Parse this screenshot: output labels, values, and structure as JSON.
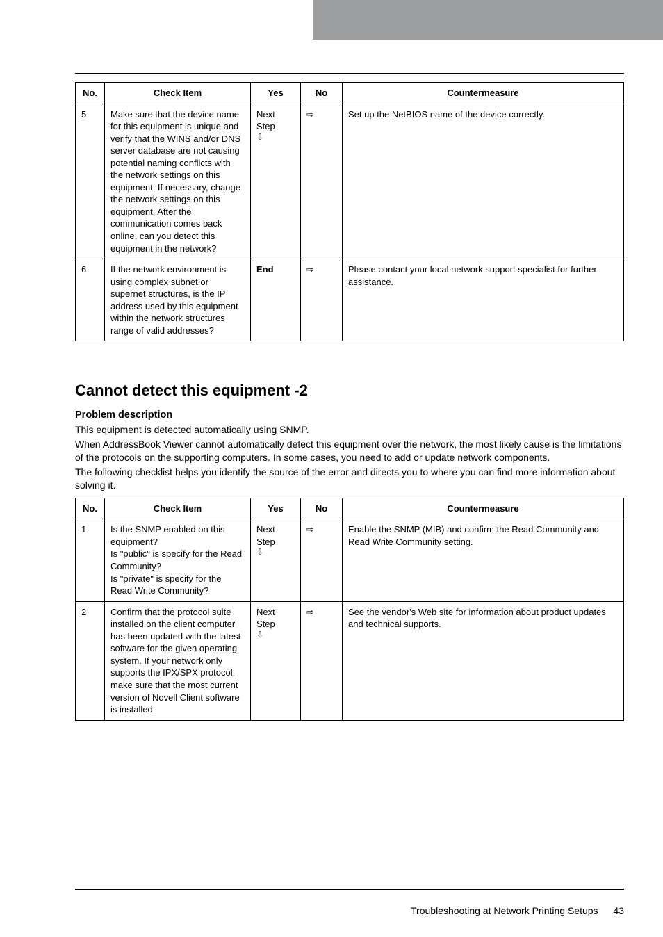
{
  "table1": {
    "headers": {
      "no": "No.",
      "check": "Check Item",
      "yes": "Yes",
      "no2": "No",
      "cm": "Countermeasure"
    },
    "rows": [
      {
        "no": "5",
        "check": "Make sure that the device name for this equipment is unique and verify that the WINS and/or DNS server database are not causing potential naming conflicts with the network settings on this equipment. If necessary, change the network settings on this equipment. After the communication comes back online, can you detect this equipment in the network?",
        "yes": "Next Step",
        "yes_arrow": "⇩",
        "no2": "⇨",
        "cm": "Set up the NetBIOS name of the device correctly."
      },
      {
        "no": "6",
        "check": "If the network environment is using complex subnet or supernet structures, is the IP address used by this equipment within the network structures range of valid addresses?",
        "yes": "End",
        "yes_arrow": "",
        "no2": "⇨",
        "cm": "Please contact your local network support specialist for further assistance."
      }
    ]
  },
  "sectionTitle": "Cannot detect this equipment -2",
  "problemHeading": "Problem description",
  "problemParas": [
    "This equipment is detected automatically using SNMP.",
    "When AddressBook Viewer cannot automatically detect this equipment over the network, the most likely cause is the limitations of the protocols on the supporting computers. In some cases, you need to add or update network components.",
    "The following checklist helps you identify the source of the error and directs you to where you can find more information about solving it."
  ],
  "table2": {
    "headers": {
      "no": "No.",
      "check": "Check Item",
      "yes": "Yes",
      "no2": "No",
      "cm": "Countermeasure"
    },
    "rows": [
      {
        "no": "1",
        "check": "Is the SNMP enabled on this equipment?\nIs \"public\" is specify for the Read Community?\nIs \"private\" is specify for the Read Write Community?",
        "yes": "Next Step",
        "yes_arrow": "⇩",
        "no2": "⇨",
        "cm": "Enable the SNMP (MIB) and confirm the Read Community and Read Write Community setting."
      },
      {
        "no": "2",
        "check": "Confirm that the protocol suite installed on the client computer has been updated with the latest software for the given operating system. If your network only supports the IPX/SPX protocol, make sure that the most current version of Novell Client software is installed.",
        "yes": "Next Step",
        "yes_arrow": "⇩",
        "no2": "⇨",
        "cm": "See the vendor's Web site for information about product updates and technical supports."
      }
    ]
  },
  "footer": {
    "text": "Troubleshooting at Network Printing Setups",
    "page": "43"
  }
}
